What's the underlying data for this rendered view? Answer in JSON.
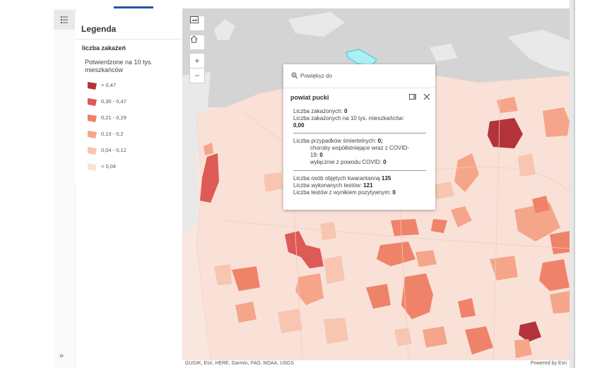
{
  "legend": {
    "title": "Legenda",
    "layer_name": "liczba zakażeń",
    "field_name": "Potwierdzone na 10 tys. mieszkańców",
    "items": [
      {
        "label": "> 0,47",
        "color": "#b3333a"
      },
      {
        "label": "0,30 - 0,47",
        "color": "#de5a57"
      },
      {
        "label": "0,21 - 0,29",
        "color": "#ef8369"
      },
      {
        "label": "0,13 - 0,2",
        "color": "#f5a589"
      },
      {
        "label": "0,04 - 0,12",
        "color": "#f8c5b1"
      },
      {
        "label": "< 0,04",
        "color": "#fbe2d9"
      }
    ]
  },
  "sidebar": {
    "expand_glyph": "»",
    "legend_icon": "legend-list-icon"
  },
  "map": {
    "attribution_left": "GUGIK, Esri, HERE, Garmin, FAO, NOAA, USGS",
    "attribution_right": "Powered by Esri",
    "controls": {
      "basemap_icon": "basemap-gallery-icon",
      "home_icon": "home-icon",
      "zoom_in": "+",
      "zoom_out": "−"
    },
    "colors": {
      "sea": "#d4d4d4",
      "land_outside": "#e9e9e9",
      "highlight": "#4fd7dc"
    }
  },
  "popup": {
    "zoom_label": "Powiększ do",
    "title": "powiat pucki",
    "section1": [
      {
        "label": "Liczba zakażonych:",
        "value": "0"
      },
      {
        "label": "Liczba zakażonych na 10 tys. mieszkańców:",
        "value": ""
      },
      {
        "label": "",
        "value": "0,00"
      }
    ],
    "section2": {
      "deaths_label": "Liczba przypadków śmiertelnych:",
      "deaths_value": "0;",
      "comorb_label": "choroby współistniejące wraz z COVID-",
      "comorb_label2": "19:",
      "comorb_value": "0",
      "covid_only_label": "wyłącznie z powodu COVID:",
      "covid_only_value": "0"
    },
    "section3": [
      {
        "label": "Liczba osób objętych kwarantanną",
        "value": "135"
      },
      {
        "label": "Liczba wykonanych testów:",
        "value": "121"
      },
      {
        "label": "Liczba testów z wynikiem pozytywnym:",
        "value": "0"
      }
    ]
  }
}
